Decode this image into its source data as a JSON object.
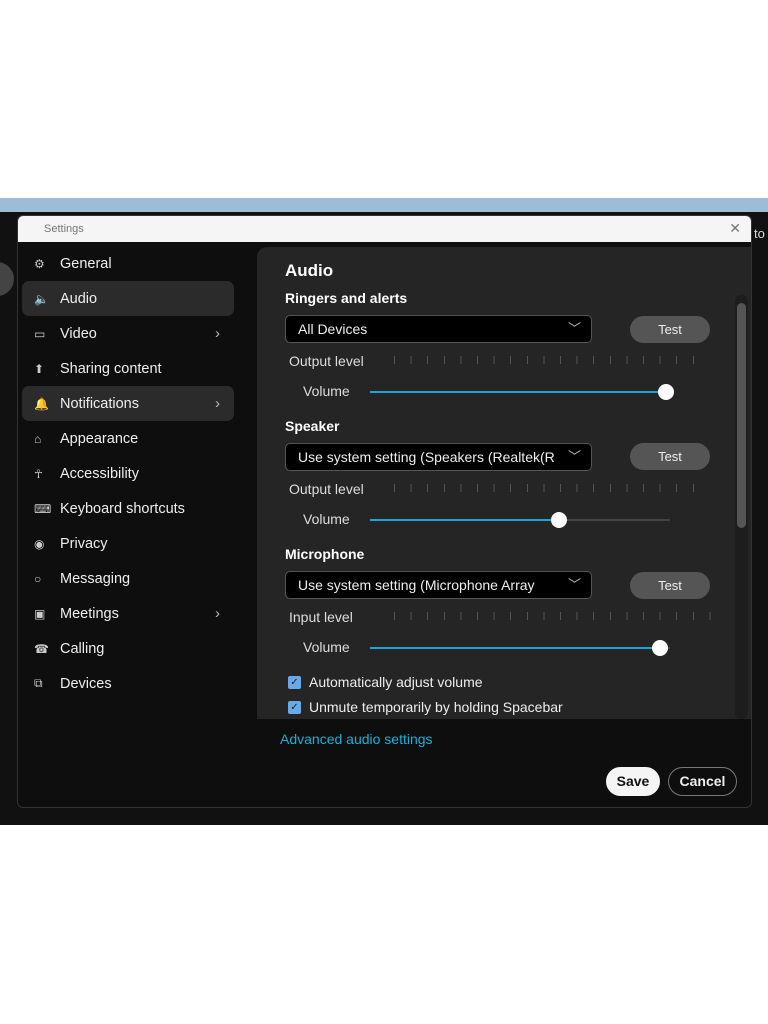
{
  "window": {
    "title": "Settings",
    "close": "✕",
    "peek_text": "to"
  },
  "sidebar": {
    "items": [
      {
        "label": "General",
        "icon": "⚙"
      },
      {
        "label": "Audio",
        "icon": "🔈"
      },
      {
        "label": "Video",
        "icon": "▭"
      },
      {
        "label": "Sharing content",
        "icon": "⬆"
      },
      {
        "label": "Notifications",
        "icon": "🔔"
      },
      {
        "label": "Appearance",
        "icon": "⌂"
      },
      {
        "label": "Accessibility",
        "icon": "☥"
      },
      {
        "label": "Keyboard shortcuts",
        "icon": "⌨"
      },
      {
        "label": "Privacy",
        "icon": "◉"
      },
      {
        "label": "Messaging",
        "icon": "○"
      },
      {
        "label": "Meetings",
        "icon": "▣"
      },
      {
        "label": "Calling",
        "icon": "☎"
      },
      {
        "label": "Devices",
        "icon": "⧉"
      }
    ]
  },
  "audio": {
    "title": "Audio",
    "ringers": {
      "heading": "Ringers and alerts",
      "device": "All Devices",
      "test": "Test",
      "level_label": "Output level",
      "volume_label": "Volume",
      "volume": 100
    },
    "speaker": {
      "heading": "Speaker",
      "device": "Use system setting (Speakers (Realtek(R",
      "test": "Test",
      "level_label": "Output level",
      "volume_label": "Volume",
      "volume": 64
    },
    "microphone": {
      "heading": "Microphone",
      "device": "Use system setting (Microphone Array",
      "test": "Test",
      "level_label": "Input level",
      "volume_label": "Volume",
      "volume": 98
    },
    "auto_adjust": {
      "label": "Automatically adjust volume",
      "checked": true
    },
    "unmute_spacebar": {
      "label": "Unmute temporarily by holding Spacebar",
      "checked": true
    },
    "advanced_link": "Advanced audio settings"
  },
  "footer": {
    "save": "Save",
    "cancel": "Cancel"
  },
  "colors": {
    "accent": "#1aa7d6",
    "checkbox": "#6aa9e8"
  }
}
